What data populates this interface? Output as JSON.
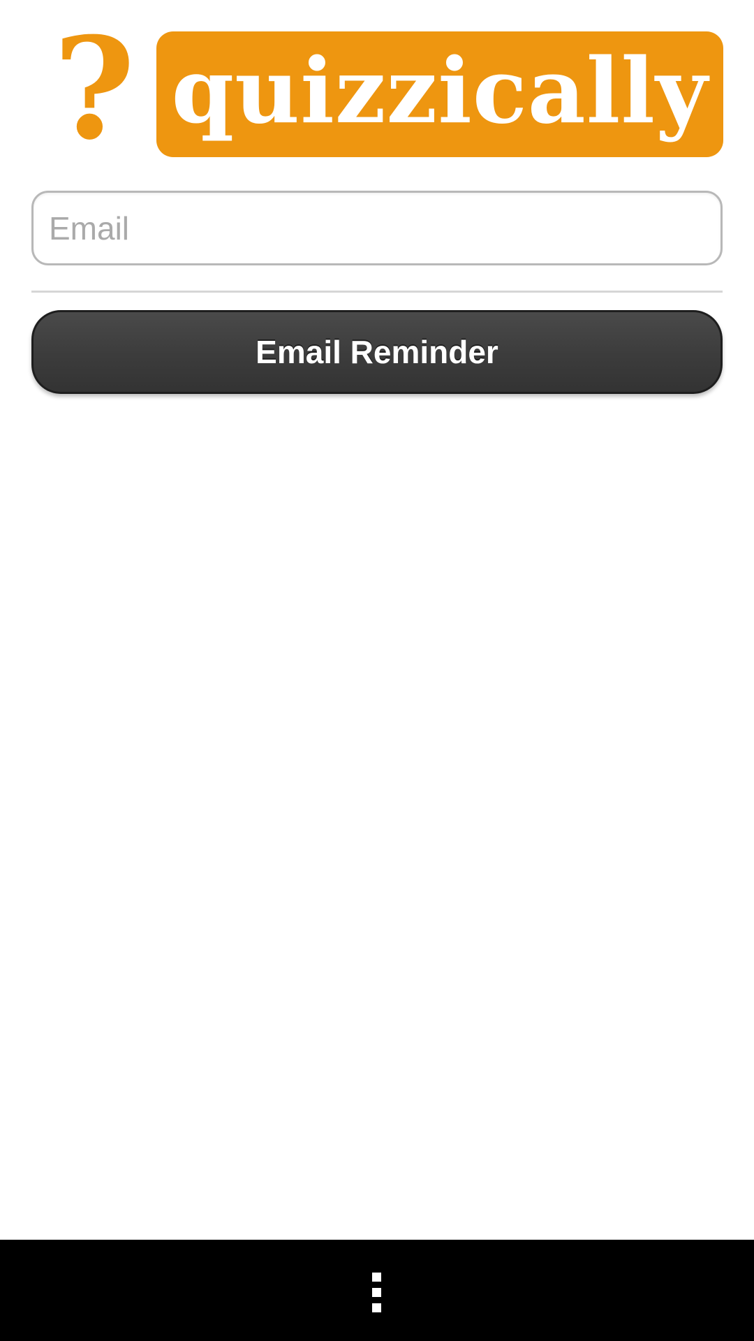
{
  "header": {
    "logo_mark": "?",
    "logo_text": "quizzically",
    "brand_color": "#ee9610"
  },
  "form": {
    "email_placeholder": "Email",
    "email_value": "",
    "button_label": "Email Reminder"
  },
  "nav_bar": {
    "menu_icon": "overflow-menu-icon"
  }
}
